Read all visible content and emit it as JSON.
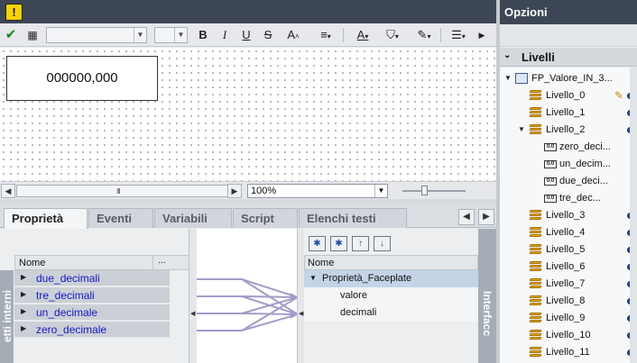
{
  "warning_icon": "warning-icon",
  "canvas": {
    "field_value": "000000,000"
  },
  "scroll": {
    "grip": "III",
    "zoom": "100%"
  },
  "tabs": [
    {
      "label": "Proprietà",
      "active": true
    },
    {
      "label": "Eventi"
    },
    {
      "label": "Variabili"
    },
    {
      "label": "Script"
    },
    {
      "label": "Elenchi testi"
    }
  ],
  "internal_vars": {
    "strip_label": "etti interni",
    "col_name": "Nome",
    "col_more": "...",
    "rows": [
      "due_decimali",
      "tre_decimali",
      "un_decimale",
      "zero_decimale"
    ]
  },
  "interface": {
    "strip_label": "Interfacc",
    "col_name": "Nome",
    "group": "Proprietà_Faceplate",
    "props": [
      "valore",
      "decimali"
    ]
  },
  "options": {
    "title": "Opzioni",
    "section": "Livelli",
    "tree": {
      "root": "FP_Valore_IN_3...",
      "levels_top": [
        "Livello_0",
        "Livello_1",
        "Livello_2"
      ],
      "children": [
        "zero_deci...",
        "un_decim...",
        "due_deci...",
        "tre_dec..."
      ],
      "levels_bottom": [
        "Livello_3",
        "Livello_4",
        "Livello_5",
        "Livello_6",
        "Livello_7",
        "Livello_8",
        "Livello_9",
        "Livello_10",
        "Livello_11"
      ]
    }
  },
  "colors": {
    "header_dark": "#3d4654",
    "link_blue": "#1515c8",
    "warning": "#f5d400",
    "selection": "#c4d4e6"
  }
}
